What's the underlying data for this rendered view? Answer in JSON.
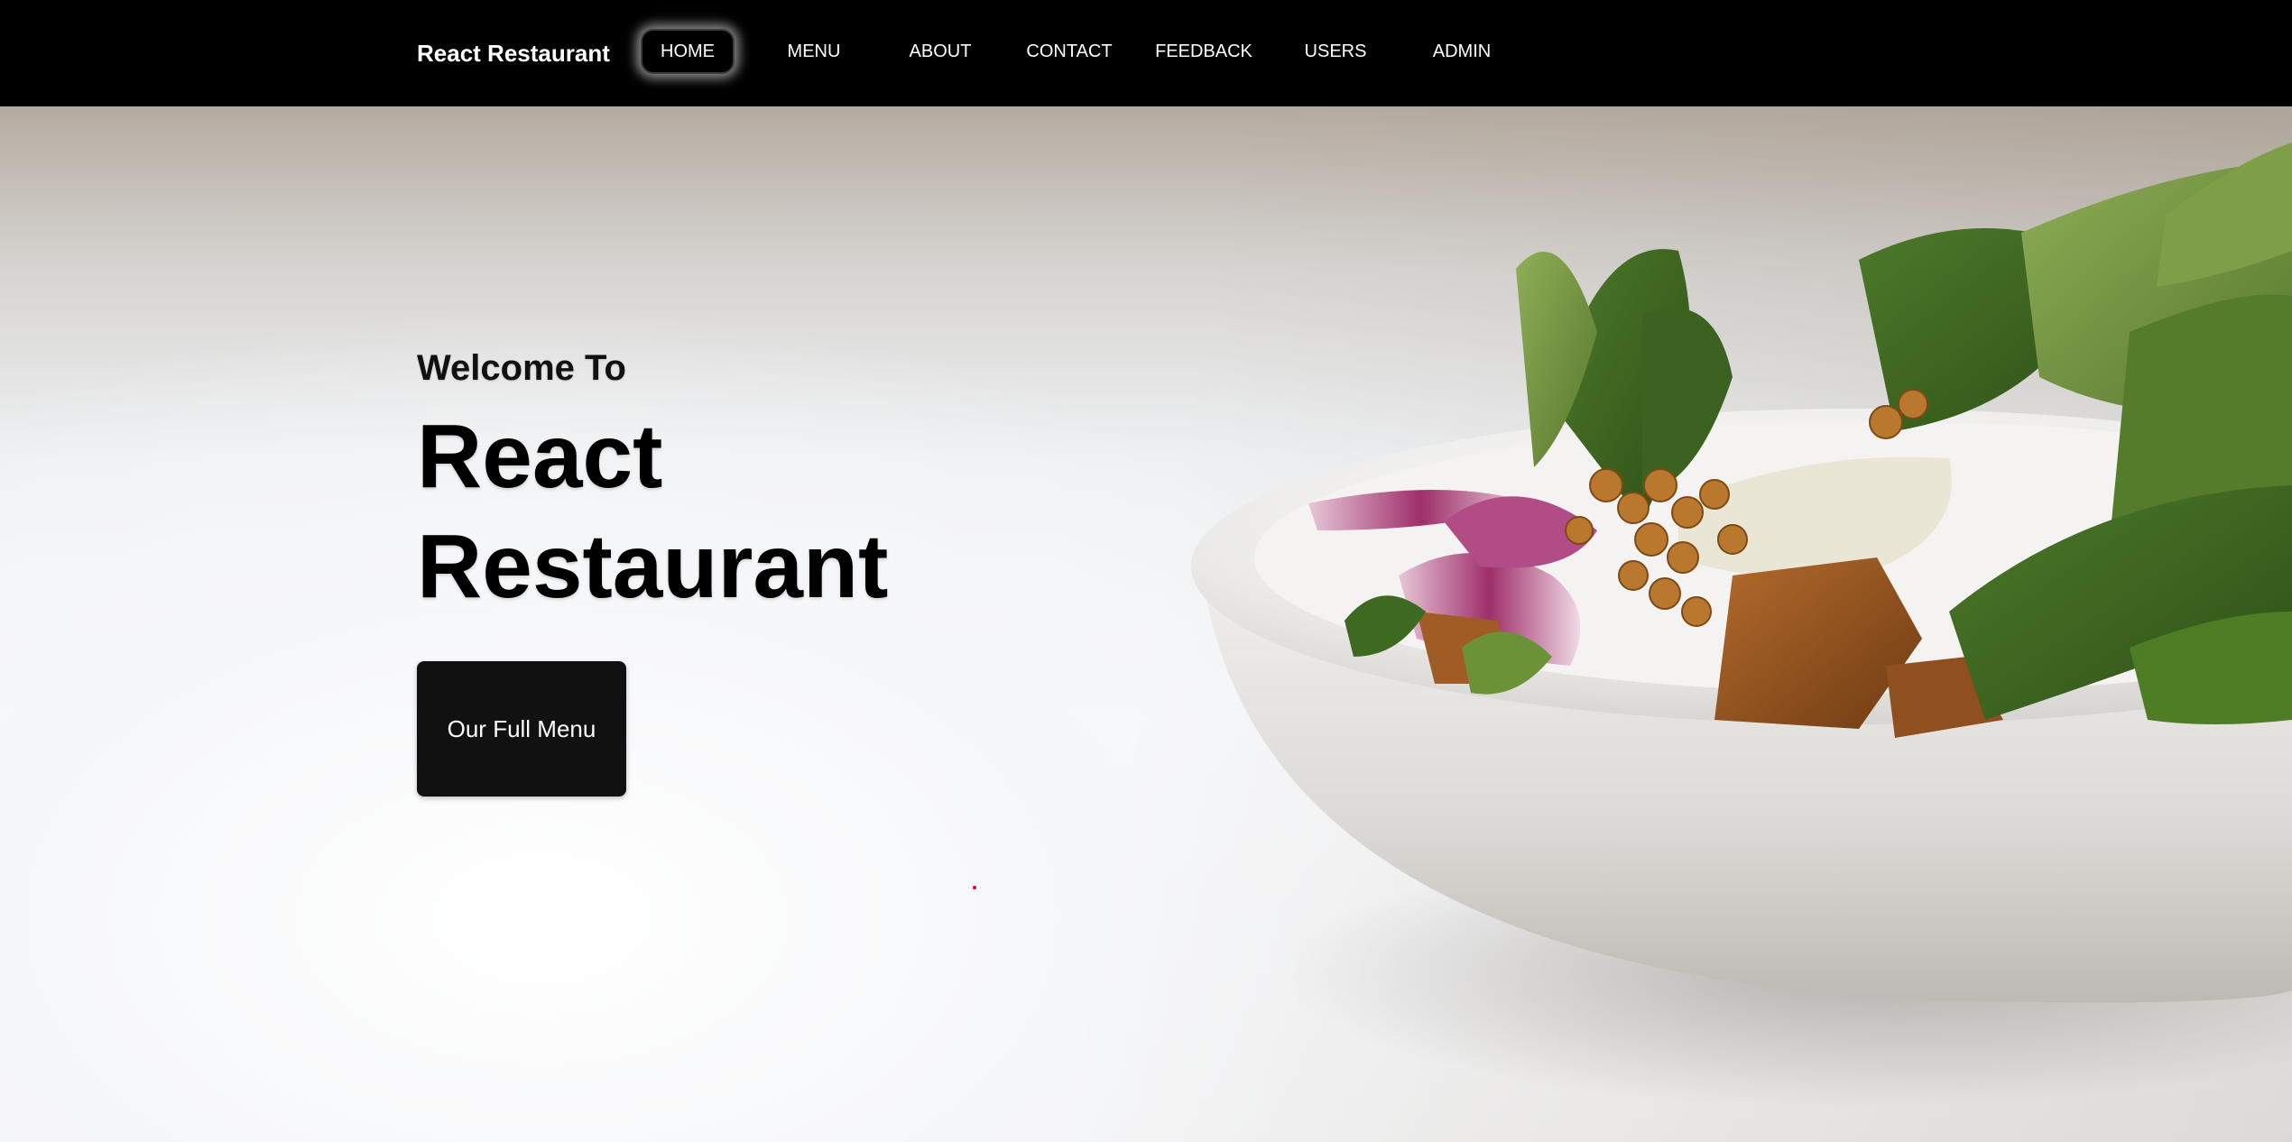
{
  "navbar": {
    "brand": "React Restaurant",
    "links": [
      {
        "label": "HOME",
        "active": true
      },
      {
        "label": "MENU",
        "active": false
      },
      {
        "label": "ABOUT",
        "active": false
      },
      {
        "label": "CONTACT",
        "active": false
      },
      {
        "label": "FEEDBACK",
        "active": false
      },
      {
        "label": "USERS",
        "active": false
      },
      {
        "label": "ADMIN",
        "active": false
      }
    ]
  },
  "hero": {
    "welcome": "Welcome To",
    "title": "React Restaurant",
    "button_label": "Our Full Menu",
    "image": "salad-bowl"
  },
  "colors": {
    "nav_bg": "#000000",
    "nav_text": "#ffffff",
    "button_bg": "#111111",
    "button_text": "#ffffff",
    "title_text": "#000000"
  }
}
